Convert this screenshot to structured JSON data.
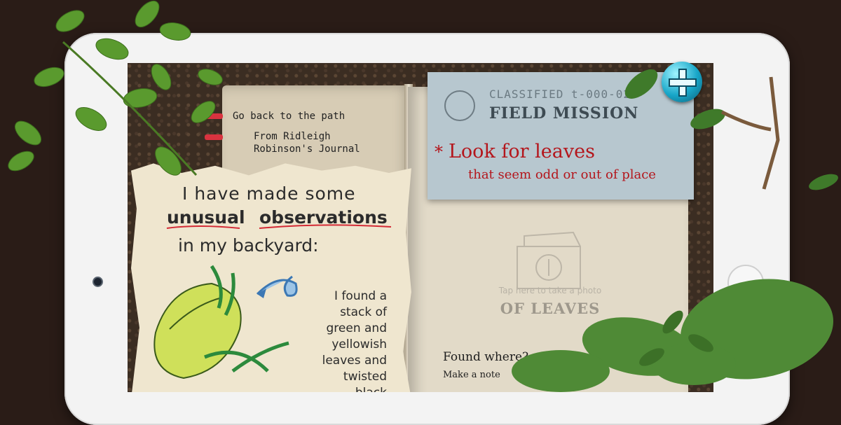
{
  "journal": {
    "back_link": "Go back to the path",
    "source_line1": "From Ridleigh",
    "source_line2": "Robinson's Journal",
    "note_line1": "I have made some",
    "note_word1": "unusual",
    "note_word2": "observations",
    "note_line3": "in my backyard:",
    "finding": [
      "I found a",
      "stack of",
      "green and",
      "yellowish",
      "leaves and",
      "twisted black"
    ]
  },
  "mission": {
    "classified": "CLASSIFIED t-000-02",
    "heading": "FIELD MISSION",
    "task_title": "Look for leaves",
    "task_subtitle": "that seem odd or out of place"
  },
  "photo": {
    "hint": "Tap here to take a photo",
    "big_label": "OF LEAVES"
  },
  "found": {
    "label": "Found where?",
    "note_label": "Make a note"
  },
  "icons": [
    "add-icon",
    "camera-icon",
    "arrow-icon",
    "seal-icon"
  ],
  "colors": {
    "accent_red": "#b4161c",
    "card_blue": "#b7c7cf",
    "button_cyan": "#18a6c8"
  }
}
